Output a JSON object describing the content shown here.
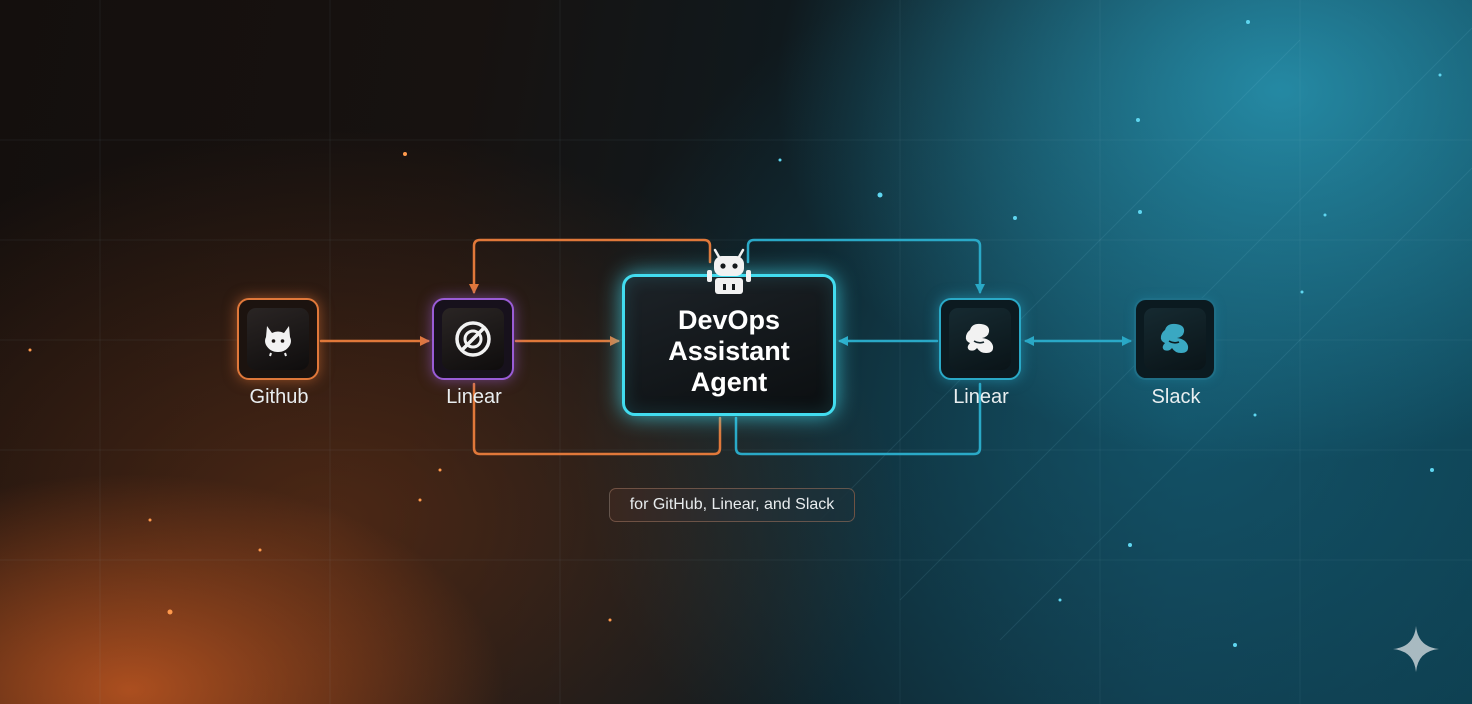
{
  "diagram": {
    "nodes": [
      {
        "id": "github",
        "label": "Github",
        "icon": "github-cat-icon",
        "color": "#e0783a"
      },
      {
        "id": "linear-left",
        "label": "Linear",
        "icon": "linear-icon",
        "color": "#9a5cd6"
      },
      {
        "id": "agent",
        "label": "DevOps Assistant Agent",
        "icon": "robot-icon",
        "color": "#42dcef"
      },
      {
        "id": "linear-right",
        "label": "Linear",
        "icon": "slack-blob-icon",
        "color": "#2aa9c7"
      },
      {
        "id": "slack",
        "label": "Slack",
        "icon": "slack-blob-icon",
        "color": "#1f6e86"
      }
    ],
    "edges": [
      {
        "from": "github",
        "to": "linear-left",
        "color": "#e0783a"
      },
      {
        "from": "linear-left",
        "to": "agent",
        "color": "#e0783a"
      },
      {
        "from": "agent",
        "to": "linear-left",
        "color": "#e0783a",
        "route": "loop-above"
      },
      {
        "from": "agent",
        "to": "linear-left",
        "color": "#e0783a",
        "route": "loop-below"
      },
      {
        "from": "linear-right",
        "to": "agent",
        "color": "#2aa9c7"
      },
      {
        "from": "agent",
        "to": "linear-right",
        "color": "#2aa9c7",
        "route": "loop-above"
      },
      {
        "from": "agent",
        "to": "linear-right",
        "color": "#2aa9c7",
        "route": "loop-below"
      },
      {
        "from": "linear-right",
        "to": "slack",
        "color": "#2aa9c7",
        "bidirectional": true
      }
    ],
    "caption": "for GitHub, Linear, and Slack"
  },
  "watermark": {
    "icon": "sparkle-icon"
  }
}
